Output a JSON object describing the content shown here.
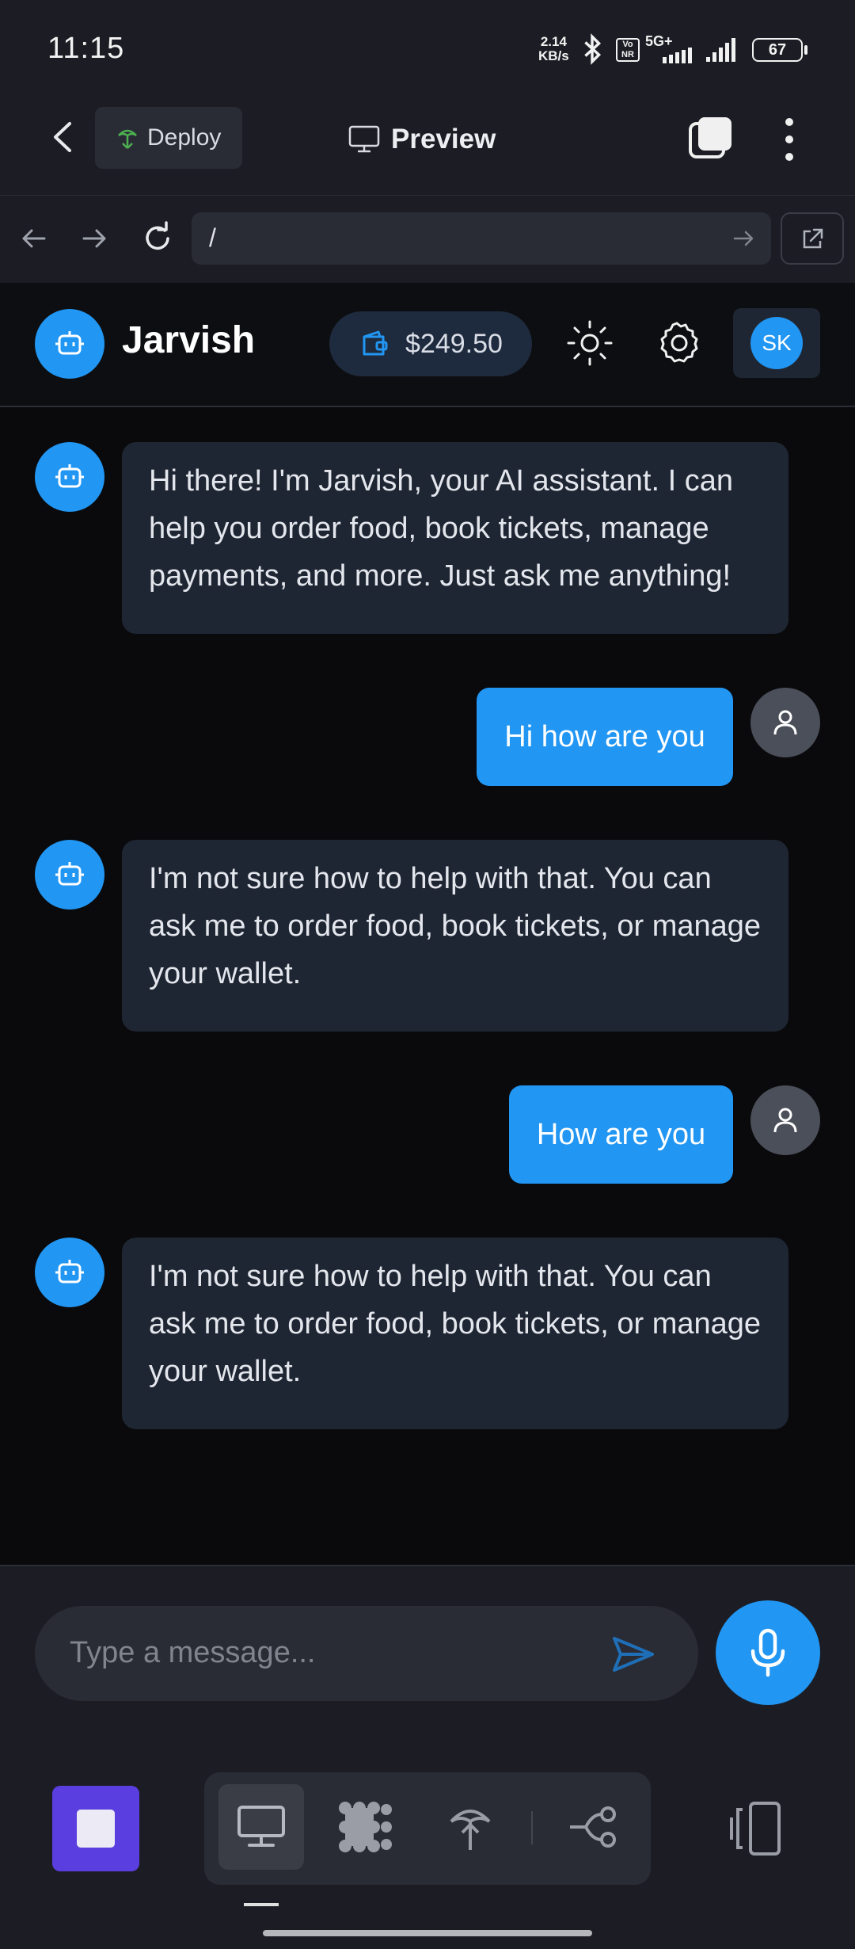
{
  "status_bar": {
    "time": "11:15",
    "net_speed_top": "2.14",
    "net_speed_bottom": "KB/s",
    "volte_top": "Vo",
    "volte_bottom": "NR",
    "network": "5G+",
    "battery": "67"
  },
  "app_bar": {
    "deploy_label": "Deploy",
    "preview_label": "Preview"
  },
  "browser": {
    "url": "/"
  },
  "chat_header": {
    "brand": "Jarvish",
    "wallet_balance": "$249.50",
    "avatar_initials": "SK"
  },
  "messages": [
    {
      "role": "bot",
      "text": "Hi there! I'm Jarvish, your AI assistant. I can help you order food, book tickets, manage payments, and more. Just ask me anything!"
    },
    {
      "role": "user",
      "text": "Hi how are you"
    },
    {
      "role": "bot",
      "text": "I'm not sure how to help with that. You can ask me to order food, book tickets, or manage your wallet."
    },
    {
      "role": "user",
      "text": "How are you"
    },
    {
      "role": "bot",
      "text": "I'm not sure how to help with that. You can ask me to order food, book tickets, or manage your wallet."
    }
  ],
  "composer": {
    "placeholder": "Type a message..."
  },
  "colors": {
    "accent": "#2196f3",
    "bubble_bot": "#1f2633",
    "stop_button": "#5b3ee0"
  },
  "icons": [
    "back-icon",
    "deploy-icon",
    "monitor-icon",
    "tabs-icon",
    "more-icon",
    "arrow-left-icon",
    "arrow-right-icon",
    "reload-icon",
    "external-link-icon",
    "bot-icon",
    "wallet-icon",
    "sun-icon",
    "gear-icon",
    "user-icon",
    "send-icon",
    "mic-icon",
    "stop-icon",
    "desktop-icon",
    "apps-icon",
    "deploy-icon",
    "flow-icon",
    "device-icon"
  ]
}
